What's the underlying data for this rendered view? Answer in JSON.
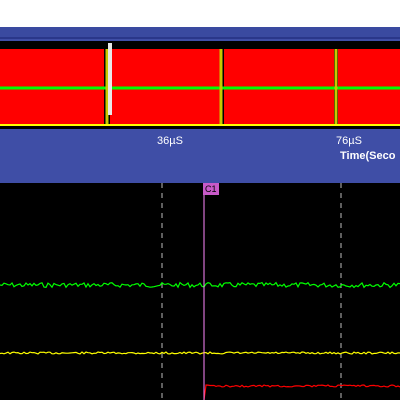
{
  "overview": {
    "tick_labels": [
      "36µS",
      "76µS"
    ],
    "axis_title": "Time(Seco"
  },
  "cursor": {
    "label": "C1"
  },
  "colors": {
    "background": "#000000",
    "panel": "#3f4ea6",
    "overview_fill": "#ff0000",
    "trace_green": "#00ff00",
    "trace_yellow": "#ffff00",
    "trace_red": "#ff0000",
    "cursor": "#ff88ff",
    "grid": "#bbbbbb"
  }
}
